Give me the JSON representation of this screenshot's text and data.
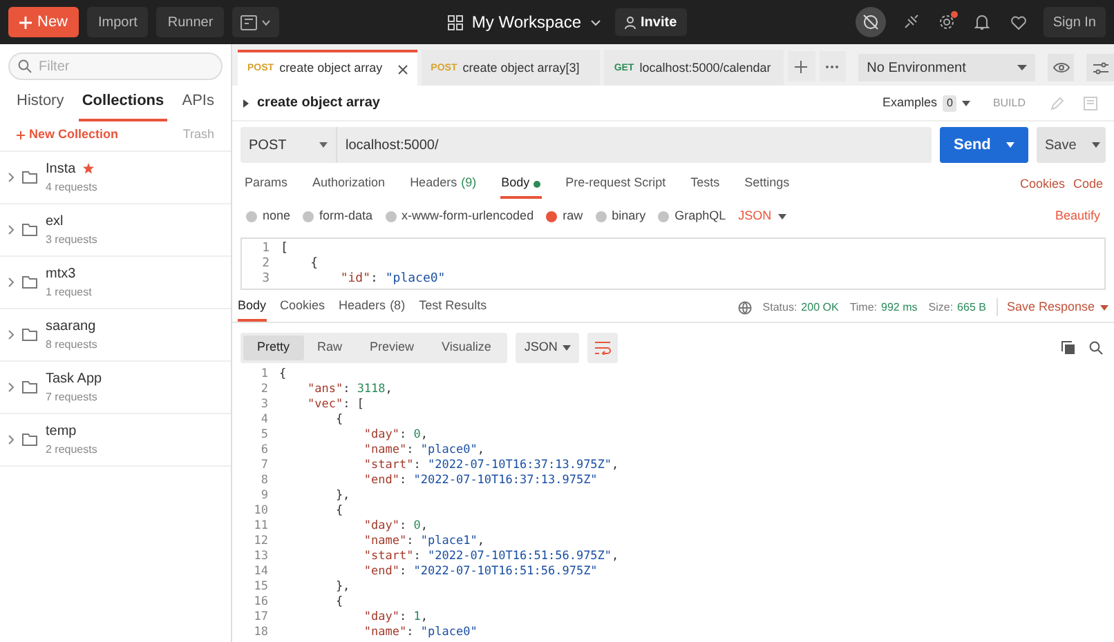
{
  "topbar": {
    "new": "New",
    "buttons": [
      "Import",
      "Runner"
    ],
    "workspace": "My Workspace",
    "invite": "Invite",
    "sign_in": "Sign In"
  },
  "sidebar": {
    "filter_placeholder": "Filter",
    "tabs": [
      {
        "label": "History",
        "selected": false
      },
      {
        "label": "Collections",
        "selected": true
      },
      {
        "label": "APIs",
        "selected": false
      }
    ],
    "new_collection": "New Collection",
    "trash": "Trash",
    "collections": [
      {
        "name": "Insta",
        "count": "4 requests",
        "starred": true
      },
      {
        "name": "exl",
        "count": "3 requests",
        "starred": false
      },
      {
        "name": "mtx3",
        "count": "1 request",
        "starred": false
      },
      {
        "name": "saarang",
        "count": "8 requests",
        "starred": false
      },
      {
        "name": "Task App",
        "count": "7 requests",
        "starred": false
      },
      {
        "name": "temp",
        "count": "2 requests",
        "starred": false
      }
    ]
  },
  "request_tabs": [
    {
      "method": "POST",
      "label": "create object array",
      "selected": true
    },
    {
      "method": "POST",
      "label": "create object array[3]",
      "selected": false
    },
    {
      "method": "GET",
      "label": "localhost:5000/calendar",
      "selected": false
    }
  ],
  "environment": "No Environment",
  "request": {
    "title": "create object array",
    "examples": "Examples",
    "examples_count": "0",
    "build": "BUILD",
    "method": "POST",
    "url": "localhost:5000/",
    "send": "Send",
    "save": "Save",
    "tabs": [
      {
        "label": "Params",
        "selected": false,
        "dot": false
      },
      {
        "label": "Authorization",
        "selected": false,
        "dot": false
      },
      {
        "label": "Headers",
        "badge": "(9)",
        "selected": false,
        "dot": false
      },
      {
        "label": "Body",
        "selected": true,
        "dot": true
      },
      {
        "label": "Pre-request Script",
        "selected": false,
        "dot": false
      },
      {
        "label": "Tests",
        "selected": false,
        "dot": false
      },
      {
        "label": "Settings",
        "selected": false,
        "dot": false
      }
    ],
    "links": [
      "Cookies",
      "Code"
    ],
    "body_types": [
      {
        "label": "none",
        "selected": false
      },
      {
        "label": "form-data",
        "selected": false
      },
      {
        "label": "x-www-form-urlencoded",
        "selected": false
      },
      {
        "label": "raw",
        "selected": true
      },
      {
        "label": "binary",
        "selected": false
      },
      {
        "label": "GraphQL",
        "selected": false
      }
    ],
    "format": "JSON",
    "beautify": "Beautify",
    "editor_lines": [
      {
        "number": "1",
        "segments": [
          {
            "kind": "punct",
            "text": "["
          }
        ]
      },
      {
        "number": "2",
        "segments": [
          {
            "kind": "punct",
            "text": "    {"
          }
        ]
      },
      {
        "number": "3",
        "segments": [
          {
            "kind": "key",
            "text": "        \"id\""
          },
          {
            "kind": "punct",
            "text": ": "
          },
          {
            "kind": "str",
            "text": "\"place0\""
          }
        ]
      }
    ]
  },
  "response": {
    "tabs": [
      {
        "label": "Body",
        "selected": true
      },
      {
        "label": "Cookies",
        "selected": false
      },
      {
        "label": "Headers",
        "badge": "(8)",
        "selected": false
      },
      {
        "label": "Test Results",
        "selected": false
      }
    ],
    "status_label": "Status:",
    "status": "200 OK",
    "time_label": "Time:",
    "time": "992 ms",
    "size_label": "Size:",
    "size": "665 B",
    "save_response": "Save Response",
    "views": [
      {
        "label": "Pretty",
        "selected": true
      },
      {
        "label": "Raw",
        "selected": false
      },
      {
        "label": "Preview",
        "selected": false
      },
      {
        "label": "Visualize",
        "selected": false
      }
    ],
    "format": "JSON",
    "lines": [
      {
        "number": "1",
        "segments": [
          {
            "kind": "punct",
            "text": "{"
          }
        ]
      },
      {
        "number": "2",
        "segments": [
          {
            "kind": "key",
            "text": "    \"ans\""
          },
          {
            "kind": "punct",
            "text": ": "
          },
          {
            "kind": "num",
            "text": "3118"
          },
          {
            "kind": "punct",
            "text": ","
          }
        ]
      },
      {
        "number": "3",
        "segments": [
          {
            "kind": "key",
            "text": "    \"vec\""
          },
          {
            "kind": "punct",
            "text": ": ["
          }
        ]
      },
      {
        "number": "4",
        "segments": [
          {
            "kind": "punct",
            "text": "        {"
          }
        ]
      },
      {
        "number": "5",
        "segments": [
          {
            "kind": "key",
            "text": "            \"day\""
          },
          {
            "kind": "punct",
            "text": ": "
          },
          {
            "kind": "num",
            "text": "0"
          },
          {
            "kind": "punct",
            "text": ","
          }
        ]
      },
      {
        "number": "6",
        "segments": [
          {
            "kind": "key",
            "text": "            \"name\""
          },
          {
            "kind": "punct",
            "text": ": "
          },
          {
            "kind": "str",
            "text": "\"place0\""
          },
          {
            "kind": "punct",
            "text": ","
          }
        ]
      },
      {
        "number": "7",
        "segments": [
          {
            "kind": "key",
            "text": "            \"start\""
          },
          {
            "kind": "punct",
            "text": ": "
          },
          {
            "kind": "str",
            "text": "\"2022-07-10T16:37:13.975Z\""
          },
          {
            "kind": "punct",
            "text": ","
          }
        ]
      },
      {
        "number": "8",
        "segments": [
          {
            "kind": "key",
            "text": "            \"end\""
          },
          {
            "kind": "punct",
            "text": ": "
          },
          {
            "kind": "str",
            "text": "\"2022-07-10T16:37:13.975Z\""
          }
        ]
      },
      {
        "number": "9",
        "segments": [
          {
            "kind": "punct",
            "text": "        },"
          }
        ]
      },
      {
        "number": "10",
        "segments": [
          {
            "kind": "punct",
            "text": "        {"
          }
        ]
      },
      {
        "number": "11",
        "segments": [
          {
            "kind": "key",
            "text": "            \"day\""
          },
          {
            "kind": "punct",
            "text": ": "
          },
          {
            "kind": "num",
            "text": "0"
          },
          {
            "kind": "punct",
            "text": ","
          }
        ]
      },
      {
        "number": "12",
        "segments": [
          {
            "kind": "key",
            "text": "            \"name\""
          },
          {
            "kind": "punct",
            "text": ": "
          },
          {
            "kind": "str",
            "text": "\"place1\""
          },
          {
            "kind": "punct",
            "text": ","
          }
        ]
      },
      {
        "number": "13",
        "segments": [
          {
            "kind": "key",
            "text": "            \"start\""
          },
          {
            "kind": "punct",
            "text": ": "
          },
          {
            "kind": "str",
            "text": "\"2022-07-10T16:51:56.975Z\""
          },
          {
            "kind": "punct",
            "text": ","
          }
        ]
      },
      {
        "number": "14",
        "segments": [
          {
            "kind": "key",
            "text": "            \"end\""
          },
          {
            "kind": "punct",
            "text": ": "
          },
          {
            "kind": "str",
            "text": "\"2022-07-10T16:51:56.975Z\""
          }
        ]
      },
      {
        "number": "15",
        "segments": [
          {
            "kind": "punct",
            "text": "        },"
          }
        ]
      },
      {
        "number": "16",
        "segments": [
          {
            "kind": "punct",
            "text": "        {"
          }
        ]
      },
      {
        "number": "17",
        "segments": [
          {
            "kind": "key",
            "text": "            \"day\""
          },
          {
            "kind": "punct",
            "text": ": "
          },
          {
            "kind": "num",
            "text": "1"
          },
          {
            "kind": "punct",
            "text": ","
          }
        ]
      },
      {
        "number": "18",
        "segments": [
          {
            "kind": "key",
            "text": "            \"name\""
          },
          {
            "kind": "punct",
            "text": ": "
          },
          {
            "kind": "str",
            "text": "\"place0\""
          }
        ]
      }
    ]
  }
}
